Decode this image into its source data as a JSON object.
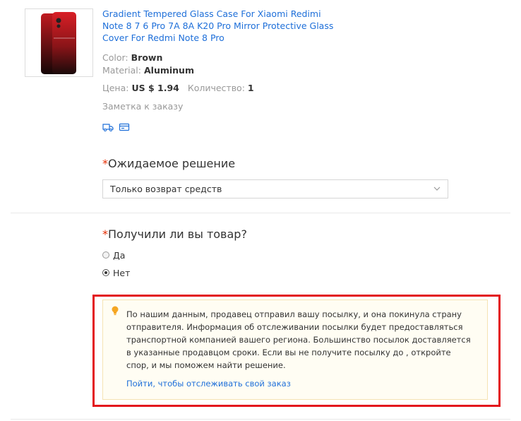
{
  "product": {
    "title": "Gradient Tempered Glass Case For Xiaomi Redimi Note 8 7 6 Pro 7A 8A K20 Pro Mirror Protective Glass Cover For Redmi Note 8 Pro",
    "color_label": "Color:",
    "color_value": "Brown",
    "material_label": "Material:",
    "material_value": "Aluminum",
    "price_label": "Цена:",
    "price_value": "US $ 1.94",
    "quantity_label": "Количество:",
    "quantity_value": "1",
    "order_note": "Заметка к заказу",
    "icons": [
      "shipping-truck-icon",
      "order-card-icon"
    ]
  },
  "resolution": {
    "required_mark": "*",
    "title": "Ожидаемое решение",
    "selected": "Только возврат средств"
  },
  "received": {
    "required_mark": "*",
    "title": "Получили ли вы товар?",
    "options": [
      {
        "label": "Да",
        "checked": false
      },
      {
        "label": "Нет",
        "checked": true
      }
    ]
  },
  "notice": {
    "icon": "lightbulb-icon",
    "text": "По нашим данным, продавец отправил вашу посылку, и она покинула страну отправителя. Информация об отслеживании посылки будет предоставляться транспортной компанией вашего региона. Большинство посылок доставляется в указанные продавцом сроки. Если вы не получите посылку до , откройте спор, и мы поможем найти решение.",
    "link": "Пойти, чтобы отслеживать свой заказ"
  },
  "colors": {
    "link": "#1e6fd9",
    "required": "#e62e04",
    "highlight_frame": "#e3161c",
    "notice_bg": "#fffdf3"
  }
}
